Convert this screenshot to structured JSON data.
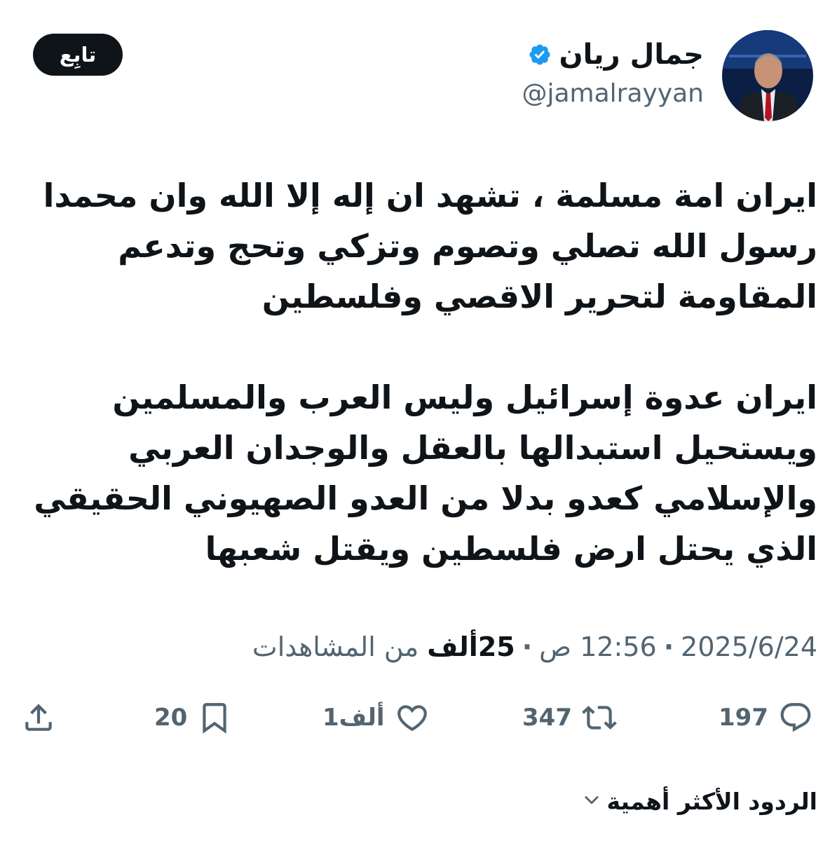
{
  "author": {
    "display_name": "جمال ريان",
    "handle": "@jamalrayyan",
    "verified_icon": "verified-badge-icon",
    "avatar_icon": "avatar-photo",
    "verified_color": "#1d9bf0"
  },
  "follow_button": {
    "label": "تابِع"
  },
  "tweet": {
    "paragraphs": [
      "ايران امة مسلمة ، تشهد ان إله إلا الله وان محمدا\nرسول الله تصلي وتصوم وتزكي وتحج وتدعم\nالمقاومة لتحرير الاقصي وفلسطين",
      "ايران عدوة إسرائيل وليس العرب والمسلمين\nويستحيل استبدالها بالعقل والوجدان العربي\nوالإسلامي كعدو بدلا من العدو الصهيوني الحقيقي\nالذي يحتل ارض فلسطين ويقتل شعبها"
    ]
  },
  "meta": {
    "date": "2025/6/24",
    "separator": "·",
    "time": "12:56 ص",
    "views_count": "25ألف",
    "views_label": "من المشاهدات"
  },
  "actions": {
    "replies": {
      "count": "197",
      "icon": "reply-icon"
    },
    "reposts": {
      "count": "347",
      "icon": "repost-icon"
    },
    "likes": {
      "count": "1ألف",
      "icon": "like-icon"
    },
    "bookmarks": {
      "count": "20",
      "icon": "bookmark-icon"
    },
    "share": {
      "icon": "share-icon"
    }
  },
  "replies_sort": {
    "label": "الردود الأكثر أهمية",
    "icon": "chevron-down-icon"
  },
  "colors": {
    "text": "#0f1419",
    "secondary": "#536471",
    "button_bg": "#0f1419"
  }
}
